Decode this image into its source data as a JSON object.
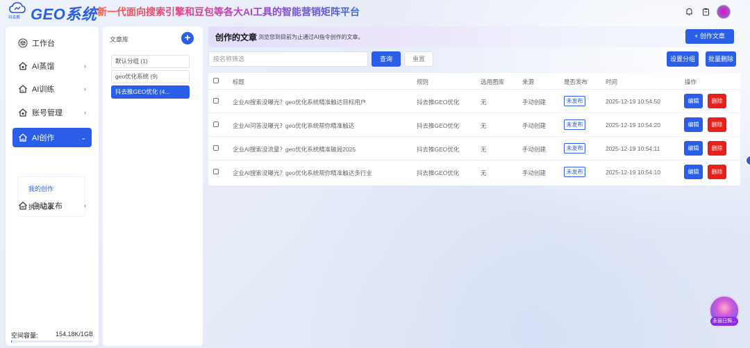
{
  "header": {
    "logo_sub": "抖去推",
    "brand": "GEO系统",
    "slogan": "新一代面向搜索引擎和豆包等各大AI工具的智能营销矩阵平台",
    "icons": [
      "bell-icon",
      "clipboard-icon",
      "avatar"
    ]
  },
  "sidebar": {
    "items": [
      {
        "label": "工作台",
        "icon": "cube-icon",
        "has_chevron": false
      },
      {
        "label": "AI蒸馏",
        "icon": "home-icon",
        "has_chevron": true
      },
      {
        "label": "AI训练",
        "icon": "robot-icon",
        "has_chevron": true
      },
      {
        "label": "账号管理",
        "icon": "home-icon",
        "has_chevron": true
      },
      {
        "label": "AI创作",
        "icon": "chart-icon",
        "has_chevron": true,
        "active": true
      },
      {
        "label": "自动发布",
        "icon": "wave-icon",
        "has_chevron": true
      }
    ],
    "submenu": [
      {
        "label": "我的创作",
        "active": true
      },
      {
        "label": "执行记录",
        "active": false
      }
    ],
    "storage_label": "空间容量:",
    "storage_value": "154.18K/1GB",
    "storage_fraction": 0.0002
  },
  "library": {
    "title": "文章库",
    "items": [
      {
        "label": "默认分组 (1)",
        "active": false
      },
      {
        "label": "geo优化系统 (9)",
        "active": false
      },
      {
        "label": "抖去推GEO优化 (4...",
        "active": true
      }
    ]
  },
  "main": {
    "title": "创作的文章",
    "description": "浏览您到目前为止通过AI指令创作的文章。",
    "create_button": "+ 创作文章",
    "search_placeholder": "按名称筛选",
    "query_button": "查询",
    "reset_button": "重置",
    "set_group_button": "设置分组",
    "batch_delete_button": "批量删除",
    "columns": [
      "标题",
      "规则",
      "选用图库",
      "来源",
      "是否发布",
      "时间",
      "操作"
    ],
    "rows": [
      {
        "title": "企业AI搜索没曝光？geo优化系统精准触达目标用户",
        "rule": "抖去推GEO优化",
        "gallery": "无",
        "source": "手动创建",
        "status": "未发布",
        "time": "2025-12-19 10:54:50"
      },
      {
        "title": "企业AI问答没曝光？geo优化系统帮你精准触达",
        "rule": "抖去推GEO优化",
        "gallery": "无",
        "source": "手动创建",
        "status": "未发布",
        "time": "2025-12-19 10:54:20"
      },
      {
        "title": "企业AI搜索没流量？geo优化系统精准破局2025",
        "rule": "抖去推GEO优化",
        "gallery": "无",
        "source": "手动创建",
        "status": "未发布",
        "time": "2025-12-19 10:54:11"
      },
      {
        "title": "企业AI搜索没曝光？geo优化系统帮你精准触达多行业",
        "rule": "抖去推GEO优化",
        "gallery": "无",
        "source": "手动创建",
        "status": "未发布",
        "time": "2025-12-19 10:54:10"
      }
    ],
    "edit_label": "编辑",
    "delete_label": "删除"
  },
  "float_badge": {
    "label": "永丽日照..."
  },
  "colors": {
    "primary": "#2a5ee8",
    "danger": "#e8201b"
  }
}
